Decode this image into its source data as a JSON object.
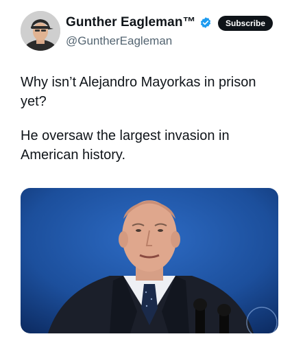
{
  "author": {
    "display_name": "Gunther Eagleman™",
    "handle": "@GuntherEagleman",
    "verified": true,
    "avatar_icon": "profile-photo-man-in-cap"
  },
  "actions": {
    "subscribe_label": "Subscribe"
  },
  "tweet": {
    "paragraphs": [
      "Why isn’t Alejandro Mayorkas in prison yet?",
      "He oversaw the largest invasion in American history."
    ]
  },
  "colors": {
    "text": "#0f1419",
    "secondary_text": "#536471",
    "verified_blue": "#1d9bf0",
    "button_bg": "#0f1419",
    "media_background": "#1c4f9c"
  }
}
